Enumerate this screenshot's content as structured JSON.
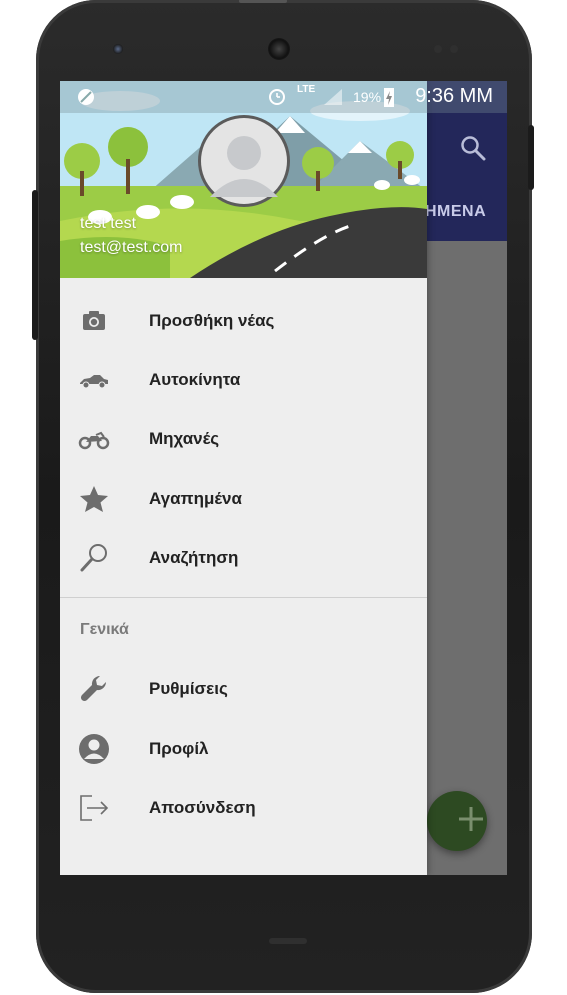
{
  "status_bar": {
    "time": "9:36 MM",
    "battery": "19%",
    "network": "LTE"
  },
  "app": {
    "tab_partial": "ΗΜΕΝΑ"
  },
  "drawer": {
    "user_name": "test test",
    "user_email": "test@test.com",
    "items": [
      {
        "label": "Προσθήκη νέας",
        "icon": "camera-icon"
      },
      {
        "label": "Αυτοκίνητα",
        "icon": "car-icon"
      },
      {
        "label": "Μηχανές",
        "icon": "motorcycle-icon"
      },
      {
        "label": "Αγαπημένα",
        "icon": "star-icon"
      },
      {
        "label": "Αναζήτηση",
        "icon": "search-icon"
      }
    ],
    "section_title": "Γενικά",
    "general_items": [
      {
        "label": "Ρυθμίσεις",
        "icon": "wrench-icon"
      },
      {
        "label": "Προφίλ",
        "icon": "account-icon"
      },
      {
        "label": "Αποσύνδεση",
        "icon": "logout-icon"
      }
    ]
  },
  "colors": {
    "app_bar": "#23275a",
    "drawer_bg": "#eeeeee",
    "fab": "#2d4a22",
    "icon": "#6d6d6d"
  }
}
